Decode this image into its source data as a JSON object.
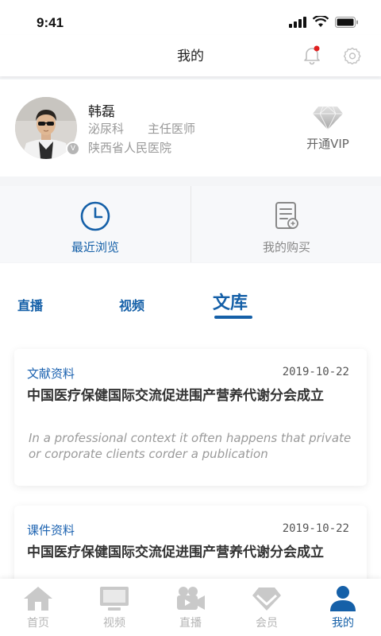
{
  "status_bar": {
    "time": "9:41"
  },
  "nav": {
    "title": "我的"
  },
  "profile": {
    "name": "韩磊",
    "department": "泌尿科",
    "role": "主任医师",
    "hospital": "陕西省人民医院",
    "vip_label": "开通VIP"
  },
  "quick_actions": [
    {
      "label": "最近浏览",
      "icon": "clock-icon",
      "color": "#1560a8"
    },
    {
      "label": "我的购买",
      "icon": "receipt-icon",
      "color": "#888888"
    }
  ],
  "content_tabs": [
    {
      "label": "直播",
      "active": false
    },
    {
      "label": "视频",
      "active": false
    },
    {
      "label": "文库",
      "active": true
    }
  ],
  "articles": [
    {
      "type": "文献资料",
      "date": "2019-10-22",
      "title": "中国医疗保健国际交流促进围产营养代谢分会成立",
      "description": "In a professional context it often happens that private or corporate clients corder a publication"
    },
    {
      "type": "课件资料",
      "date": "2019-10-22",
      "title": "中国医疗保健国际交流促进围产营养代谢分会成立"
    }
  ],
  "tabbar": [
    {
      "label": "首页",
      "icon": "home-icon",
      "active": false
    },
    {
      "label": "视频",
      "icon": "monitor-icon",
      "active": false
    },
    {
      "label": "直播",
      "icon": "camera-icon",
      "active": false
    },
    {
      "label": "会员",
      "icon": "diamond-icon",
      "active": false
    },
    {
      "label": "我的",
      "icon": "person-icon",
      "active": true
    }
  ],
  "colors": {
    "accent": "#1560a8",
    "notification_dot": "#e02020",
    "inactive": "#b5b5b5"
  }
}
